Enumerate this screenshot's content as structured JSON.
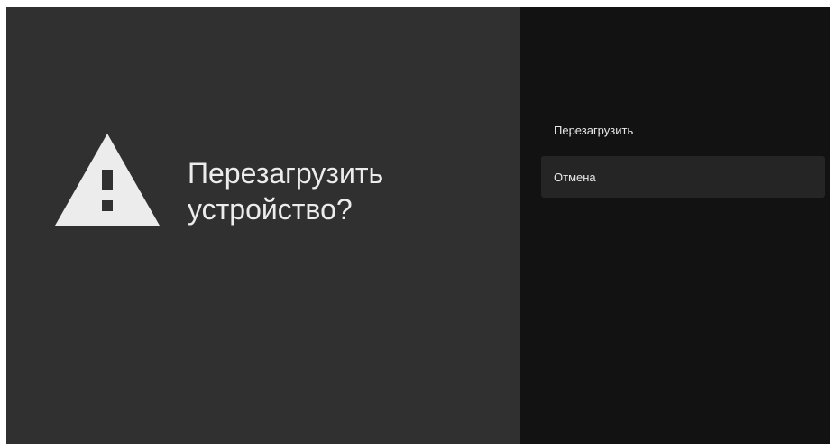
{
  "dialog": {
    "icon": "warning-icon",
    "title_line1": "Перезагрузить",
    "title_line2": "устройство?"
  },
  "actions": [
    {
      "label": "Перезагрузить",
      "focused": false
    },
    {
      "label": "Отмена",
      "focused": true
    }
  ],
  "colors": {
    "left_background": "#303030",
    "right_background": "#121212",
    "focused_item": "#252525",
    "icon": "#ececec",
    "text": "#ececec"
  }
}
